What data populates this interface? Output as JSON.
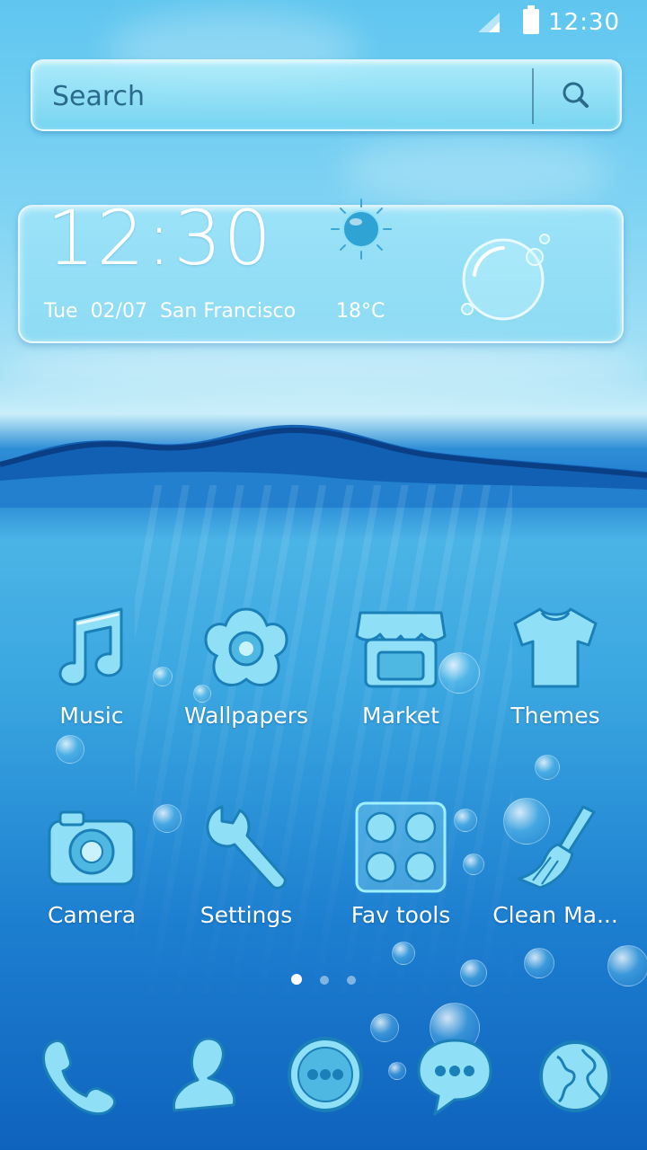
{
  "status_bar": {
    "time": "12:30"
  },
  "search": {
    "placeholder": "Search"
  },
  "clock_widget": {
    "time": "12:30",
    "date": "Tue  02/07  San Francisco",
    "temperature": "18°C"
  },
  "apps": [
    {
      "label": "Music",
      "icon": "music-note-icon"
    },
    {
      "label": "Wallpapers",
      "icon": "flower-icon"
    },
    {
      "label": "Market",
      "icon": "store-icon"
    },
    {
      "label": "Themes",
      "icon": "tshirt-icon"
    },
    {
      "label": "Camera",
      "icon": "camera-icon"
    },
    {
      "label": "Settings",
      "icon": "wrench-icon"
    },
    {
      "label": "Fav tools",
      "icon": "folder-grid-icon"
    },
    {
      "label": "Clean Ma...",
      "icon": "broom-icon"
    }
  ],
  "page_indicator": {
    "pages": 3,
    "current": 1
  },
  "dock": [
    "phone-icon",
    "contacts-icon",
    "messages-icon",
    "chat-icon",
    "browser-globe-icon"
  ],
  "colors": {
    "water_icon": "#8fe0f6",
    "icon_stroke": "#1b7fb8",
    "text": "#ffffff"
  }
}
